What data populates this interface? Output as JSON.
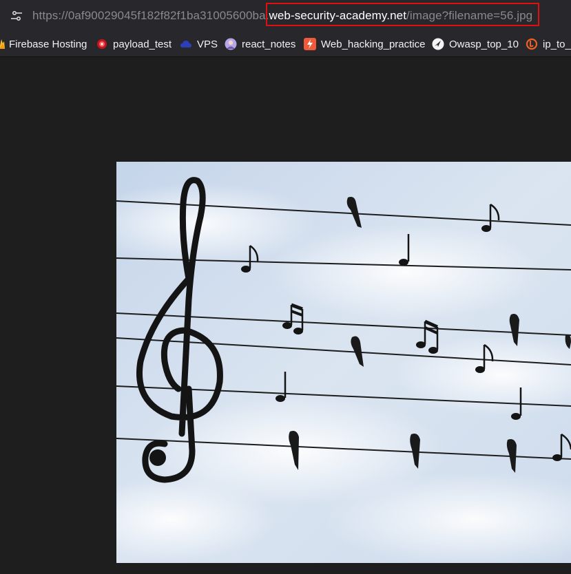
{
  "address_bar": {
    "url_prefix": "https://0af90029045f182f82f1ba31005600ba.",
    "url_host": "web-security-academy.net",
    "url_path": "/image?filename=56.jpg",
    "site_info_icon": "tune-icon"
  },
  "highlight": {
    "color": "#e01010"
  },
  "bookmarks": [
    {
      "label": "Firebase Hosting",
      "icon": "firebase-icon"
    },
    {
      "label": "payload_test",
      "icon": "payload-icon"
    },
    {
      "label": "VPS",
      "icon": "cloud-icon"
    },
    {
      "label": "react_notes",
      "icon": "avatar-icon"
    },
    {
      "label": "Web_hacking_practice",
      "icon": "bolt-icon"
    },
    {
      "label": "Owasp_top_10",
      "icon": "compass-icon"
    },
    {
      "label": "ip_to_l",
      "icon": "bitly-icon"
    }
  ],
  "image": {
    "subject": "treble-clef-birds-on-wires",
    "sky_color": "#cfdcec"
  }
}
